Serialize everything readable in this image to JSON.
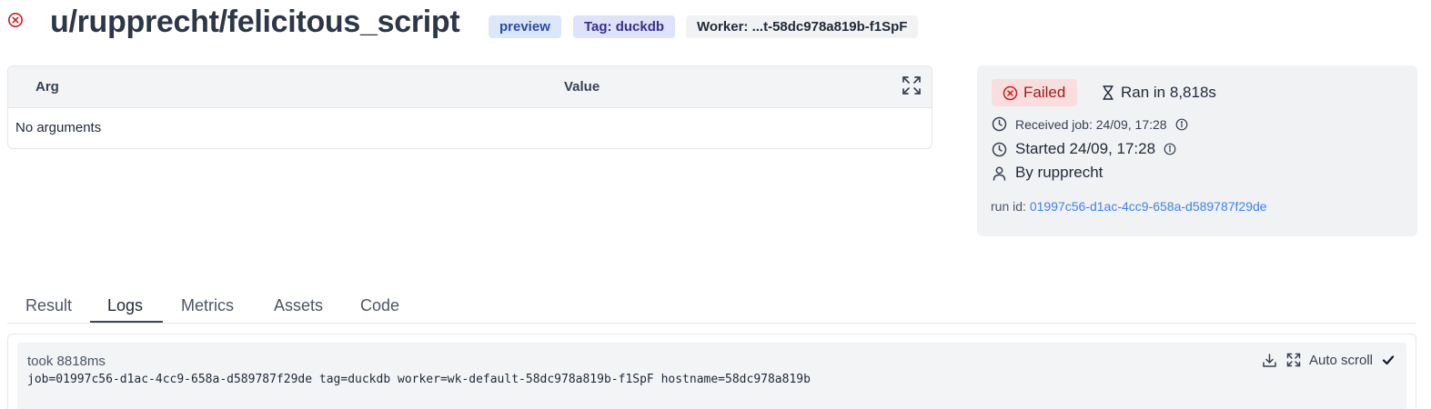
{
  "header": {
    "status_icon": "x-circle-icon",
    "title": "u/rupprecht/felicitous_script",
    "badges": {
      "preview": "preview",
      "tag": "Tag: duckdb",
      "worker": "Worker: ...t-58dc978a819b-f1SpF"
    }
  },
  "args_table": {
    "columns": [
      "Arg",
      "Value"
    ],
    "expand_icon": "expand-icon",
    "empty_text": "No arguments"
  },
  "job_info": {
    "status": "Failed",
    "ran_in": "Ran in 8,818s",
    "received": "Received job: 24/09, 17:28",
    "started": "Started 24/09, 17:28",
    "by": "By rupprecht",
    "run_id_label": "run id: ",
    "run_id": "01997c56-d1ac-4cc9-658a-d589787f29de"
  },
  "tabs": {
    "items": [
      "Result",
      "Logs",
      "Metrics",
      "Assets",
      "Code"
    ],
    "active": "Logs"
  },
  "logs": {
    "took": "took 8818ms",
    "line": "job=01997c56-d1ac-4cc9-658a-d589787f29de tag=duckdb worker=wk-default-58dc978a819b-f1SpF hostname=58dc978a819b",
    "auto_scroll_label": "Auto scroll",
    "auto_scroll_checked": true
  },
  "colors": {
    "failed_text": "#9b1c1c",
    "failed_bg": "#fadddd",
    "link": "#3b82f6",
    "error_red": "#c81e1e"
  }
}
